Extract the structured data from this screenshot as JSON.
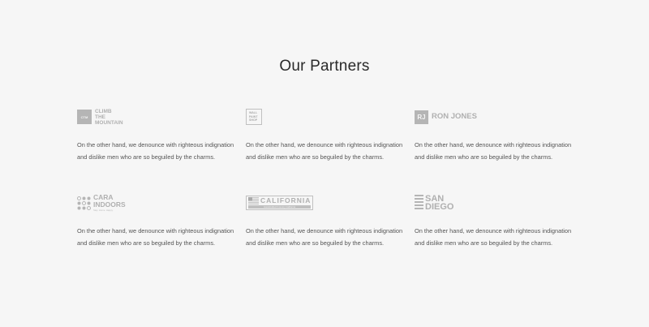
{
  "section": {
    "title": "Our Partners"
  },
  "partners": [
    {
      "logo_name": "climb-the-mountain-logo",
      "logo_badge": "CTM",
      "logo_lines": [
        "CLIMB",
        "THE",
        "MOUNTAIN"
      ],
      "description": "On the other hand, we denounce with righteous indignation and dislike men who are so beguiled by the charms."
    },
    {
      "logo_name": "wall-paint-shop-logo",
      "logo_lines": [
        "WALL",
        "PAINT",
        "SHOP"
      ],
      "description": "On the other hand, we denounce with righteous indignation and dislike men who are so beguiled by the charms."
    },
    {
      "logo_name": "ron-jones-logo",
      "logo_badge": "RJ",
      "logo_text": "RON JONES",
      "description": "On the other hand, we denounce with righteous indignation and dislike men who are so beguiled by the charms."
    },
    {
      "logo_name": "cara-indoors-logo",
      "logo_lines": [
        "CARA",
        "INDOORS"
      ],
      "logo_tagline": "Stay. Home. Happy.",
      "description": "On the other hand, we denounce with righteous indignation and dislike men who are so beguiled by the charms."
    },
    {
      "logo_name": "california-logo",
      "logo_text": "CALIFORNIA",
      "logo_tagline": "Handcrafted in sunny California",
      "description": "On the other hand, we denounce with righteous indignation and dislike men who are so beguiled by the charms."
    },
    {
      "logo_name": "san-diego-logo",
      "logo_lines": [
        "SAN",
        "DIEGO"
      ],
      "description": "On the other hand, we denounce with righteous indignation and dislike men who are so beguiled by the charms."
    }
  ],
  "colors": {
    "background": "#f6f6f6",
    "logo_gray": "#b0b0b0",
    "text": "#555555",
    "title": "#2a2a2a"
  }
}
